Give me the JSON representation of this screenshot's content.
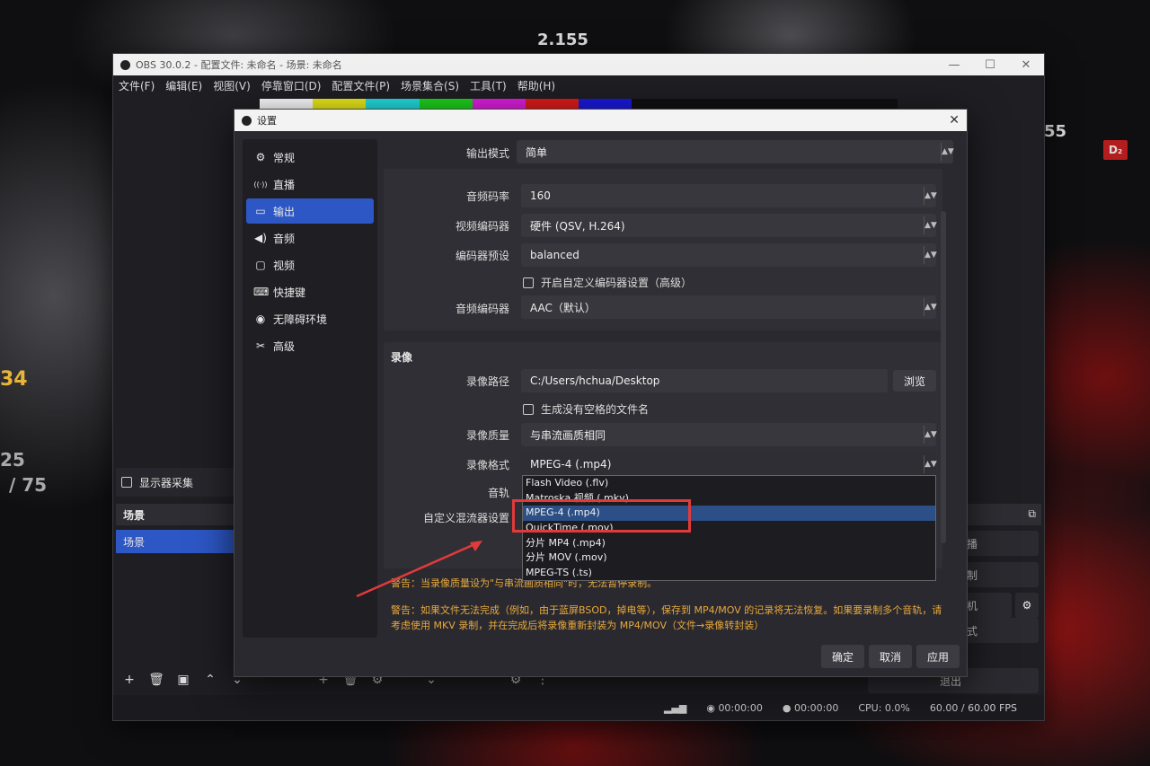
{
  "background": {
    "deco_text_1": "2.155",
    "deco_text_2": "55",
    "deco_text_3": "D₂",
    "deco_text_4": "34",
    "deco_text_5": "25",
    "deco_text_6": "/ 75"
  },
  "window": {
    "title": "OBS 30.0.2 - 配置文件: 未命名 - 场景: 未命名",
    "menu": [
      "文件(F)",
      "编辑(E)",
      "视图(V)",
      "停靠窗口(D)",
      "配置文件(P)",
      "场景集合(S)",
      "工具(T)",
      "帮助(H)"
    ],
    "preview_colors": [
      "#ffffff",
      "#ecec1a",
      "#22dedf",
      "#1cd51c",
      "#e01ee0",
      "#e01b1b",
      "#1a1ae0",
      "#111111",
      "#111111",
      "#111111",
      "#111111",
      "#111111"
    ],
    "source_label": "显示器采集",
    "scenes_header": "场景",
    "scene_item": "场景",
    "right_buttons": [
      "播",
      "制",
      "机",
      "式",
      "退出"
    ],
    "status": {
      "time1": "00:00:00",
      "time2": "00:00:00",
      "cpu": "CPU: 0.0%",
      "fps": "60.00 / 60.00 FPS"
    }
  },
  "dialog": {
    "title": "设置",
    "nav": [
      {
        "icon": "gear-icon",
        "glyph": "⚙",
        "label": "常规"
      },
      {
        "icon": "broadcast-icon",
        "glyph": "((·))",
        "label": "直播"
      },
      {
        "icon": "output-icon",
        "glyph": "▭",
        "label": "输出"
      },
      {
        "icon": "speaker-icon",
        "glyph": "◀)",
        "label": "音频"
      },
      {
        "icon": "monitor-icon",
        "glyph": "▢",
        "label": "视频"
      },
      {
        "icon": "keyboard-icon",
        "glyph": "⌨",
        "label": "快捷键"
      },
      {
        "icon": "accessibility-icon",
        "glyph": "◉",
        "label": "无障碍环境"
      },
      {
        "icon": "wrench-icon",
        "glyph": "✂",
        "label": "高级"
      }
    ],
    "output_mode_label": "输出模式",
    "output_mode_value": "简单",
    "streaming": {
      "audio_bitrate_label": "音频码率",
      "audio_bitrate_value": "160",
      "video_encoder_label": "视频编码器",
      "video_encoder_value": "硬件 (QSV, H.264)",
      "encoder_preset_label": "编码器预设",
      "encoder_preset_value": "balanced",
      "custom_encoder_label": "开启自定义编码器设置（高级）",
      "audio_encoder_label": "音频编码器",
      "audio_encoder_value": "AAC（默认）"
    },
    "recording": {
      "section_title": "录像",
      "path_label": "录像路径",
      "path_value": "C:/Users/hchua/Desktop",
      "browse_label": "浏览",
      "no_space_label": "生成没有空格的文件名",
      "quality_label": "录像质量",
      "quality_value": "与串流画质相同",
      "format_label": "录像格式",
      "format_value": "MPEG-4 (.mp4)",
      "tracks_label": "音轨",
      "muxer_label": "自定义混流器设置",
      "format_options": [
        "Flash Video (.flv)",
        "Matroska 视频 (.mkv)",
        "MPEG-4 (.mp4)",
        "QuickTime (.mov)",
        "分片 MP4 (.mp4)",
        "分片 MOV (.mov)",
        "MPEG-TS (.ts)"
      ],
      "selected_index": 2
    },
    "warning1": "警告：当录像质量设为\"与串流画质相同\"时，无法暂停录制。",
    "warning2": "警告：如果文件无法完成（例如，由于蓝屏BSOD，掉电等），保存到 MP4/MOV 的记录将无法恢复。如果要录制多个音轨，请考虑使用 MKV 录制，并在完成后将录像重新封装为 MP4/MOV（文件→录像转封装）",
    "buttons": {
      "ok": "确定",
      "cancel": "取消",
      "apply": "应用"
    }
  },
  "annotation_color": "#e23a3a"
}
